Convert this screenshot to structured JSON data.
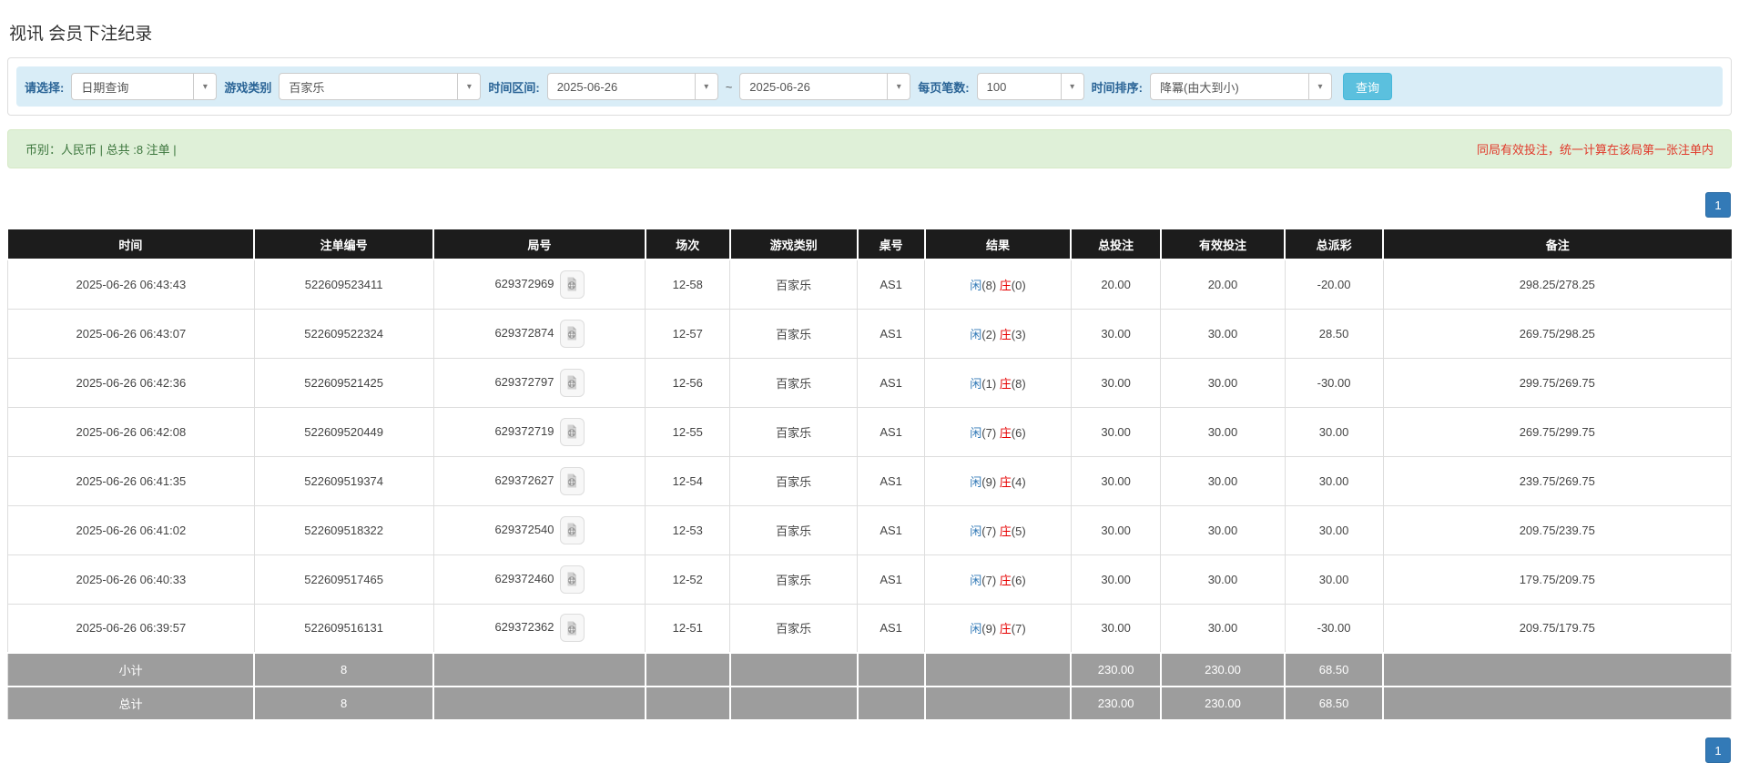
{
  "page": {
    "title": "视讯 会员下注纪录"
  },
  "filters": {
    "select_label": "请选择:",
    "select_value": "日期查询",
    "game_type_label": "游戏类别",
    "game_type_value": "百家乐",
    "date_range_label": "时间区间:",
    "date_from": "2025-06-26",
    "date_to": "2025-06-26",
    "range_separator": "~",
    "page_size_label": "每页笔数:",
    "page_size_value": "100",
    "sort_label": "时间排序:",
    "sort_value": "降冪(由大到小)",
    "search_button": "查询"
  },
  "notice": {
    "left_text": "币别：人民币 | 总共 :8 注单 |",
    "right_text": "同局有效投注，统一计算在该局第一张注单内"
  },
  "pagination": {
    "page": "1"
  },
  "table": {
    "headers": [
      "时间",
      "注单编号",
      "局号",
      "场次",
      "游戏类别",
      "桌号",
      "结果",
      "总投注",
      "有效投注",
      "总派彩",
      "备注"
    ],
    "rows": [
      {
        "time": "2025-06-26 06:43:43",
        "bet_id": "522609523411",
        "round_id": "629372969",
        "session": "12-58",
        "game": "百家乐",
        "table_no": "AS1",
        "player": "闲",
        "player_n": "(8)",
        "banker": "庄",
        "banker_n": "(0)",
        "total_bet": "20.00",
        "valid_bet": "20.00",
        "payout": "-20.00",
        "remark": "298.25/278.25"
      },
      {
        "time": "2025-06-26 06:43:07",
        "bet_id": "522609522324",
        "round_id": "629372874",
        "session": "12-57",
        "game": "百家乐",
        "table_no": "AS1",
        "player": "闲",
        "player_n": "(2)",
        "banker": "庄",
        "banker_n": "(3)",
        "total_bet": "30.00",
        "valid_bet": "30.00",
        "payout": "28.50",
        "remark": "269.75/298.25"
      },
      {
        "time": "2025-06-26 06:42:36",
        "bet_id": "522609521425",
        "round_id": "629372797",
        "session": "12-56",
        "game": "百家乐",
        "table_no": "AS1",
        "player": "闲",
        "player_n": "(1)",
        "banker": "庄",
        "banker_n": "(8)",
        "total_bet": "30.00",
        "valid_bet": "30.00",
        "payout": "-30.00",
        "remark": "299.75/269.75"
      },
      {
        "time": "2025-06-26 06:42:08",
        "bet_id": "522609520449",
        "round_id": "629372719",
        "session": "12-55",
        "game": "百家乐",
        "table_no": "AS1",
        "player": "闲",
        "player_n": "(7)",
        "banker": "庄",
        "banker_n": "(6)",
        "total_bet": "30.00",
        "valid_bet": "30.00",
        "payout": "30.00",
        "remark": "269.75/299.75"
      },
      {
        "time": "2025-06-26 06:41:35",
        "bet_id": "522609519374",
        "round_id": "629372627",
        "session": "12-54",
        "game": "百家乐",
        "table_no": "AS1",
        "player": "闲",
        "player_n": "(9)",
        "banker": "庄",
        "banker_n": "(4)",
        "total_bet": "30.00",
        "valid_bet": "30.00",
        "payout": "30.00",
        "remark": "239.75/269.75"
      },
      {
        "time": "2025-06-26 06:41:02",
        "bet_id": "522609518322",
        "round_id": "629372540",
        "session": "12-53",
        "game": "百家乐",
        "table_no": "AS1",
        "player": "闲",
        "player_n": "(7)",
        "banker": "庄",
        "banker_n": "(5)",
        "total_bet": "30.00",
        "valid_bet": "30.00",
        "payout": "30.00",
        "remark": "209.75/239.75"
      },
      {
        "time": "2025-06-26 06:40:33",
        "bet_id": "522609517465",
        "round_id": "629372460",
        "session": "12-52",
        "game": "百家乐",
        "table_no": "AS1",
        "player": "闲",
        "player_n": "(7)",
        "banker": "庄",
        "banker_n": "(6)",
        "total_bet": "30.00",
        "valid_bet": "30.00",
        "payout": "30.00",
        "remark": "179.75/209.75"
      },
      {
        "time": "2025-06-26 06:39:57",
        "bet_id": "522609516131",
        "round_id": "629372362",
        "session": "12-51",
        "game": "百家乐",
        "table_no": "AS1",
        "player": "闲",
        "player_n": "(9)",
        "banker": "庄",
        "banker_n": "(7)",
        "total_bet": "30.00",
        "valid_bet": "30.00",
        "payout": "-30.00",
        "remark": "209.75/179.75"
      }
    ],
    "subtotal": {
      "label": "小计",
      "count": "8",
      "total_bet": "230.00",
      "valid_bet": "230.00",
      "payout": "68.50"
    },
    "total": {
      "label": "总计",
      "count": "8",
      "total_bet": "230.00",
      "valid_bet": "230.00",
      "payout": "68.50"
    }
  },
  "colors": {
    "header_bg": "#1c1c1c",
    "link_blue": "#337ab7",
    "negative_red": "#e60000",
    "notice_green_text": "#3c763d",
    "notice_red_text": "#e03a2b",
    "filter_bar_bg": "#d9edf7",
    "notice_bg": "#dff0d8",
    "summary_gray": "#9d9d9d",
    "search_button_bg": "#5bc0de"
  }
}
